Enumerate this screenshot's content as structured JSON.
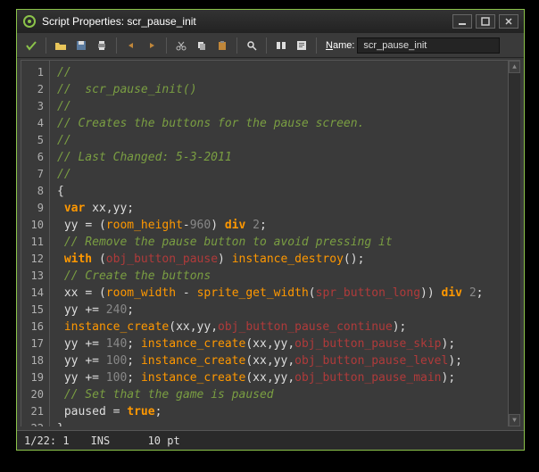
{
  "titlebar": {
    "title": "Script Properties: scr_pause_init"
  },
  "toolbar": {
    "name_label": "Name:",
    "name_value": "scr_pause_init"
  },
  "gutter": {
    "lines": 22
  },
  "code_lines": [
    {
      "t": "cmt",
      "text": "//"
    },
    {
      "t": "cmt",
      "text": "//  scr_pause_init()"
    },
    {
      "t": "cmt",
      "text": "//"
    },
    {
      "t": "cmt",
      "text": "// Creates the buttons for the pause screen."
    },
    {
      "t": "cmt",
      "text": "//"
    },
    {
      "t": "cmt",
      "text": "// Last Changed: 5-3-2011"
    },
    {
      "t": "cmt",
      "text": "//"
    },
    {
      "t": "raw",
      "html": "<span class='c-sym'>{</span>"
    },
    {
      "t": "raw",
      "html": " <span class='c-kw'>var</span> <span class='c-var'>xx,yy;</span>"
    },
    {
      "t": "raw",
      "html": " <span class='c-var'>yy</span> <span class='c-op'>=</span> <span class='c-op'>(</span><span class='c-fn'>room_height</span><span class='c-op'>-</span><span class='c-num'>960</span><span class='c-op'>)</span> <span class='c-kw'>div</span> <span class='c-num'>2</span><span class='c-op'>;</span>"
    },
    {
      "t": "raw",
      "html": " <span class='c-cmt'>// Remove the pause button to avoid pressing it</span>"
    },
    {
      "t": "raw",
      "html": " <span class='c-kw'>with</span> <span class='c-op'>(</span><span class='c-obj'>obj_button_pause</span><span class='c-op'>)</span> <span class='c-fn'>instance_destroy</span><span class='c-op'>();</span>"
    },
    {
      "t": "raw",
      "html": " <span class='c-cmt'>// Create the buttons</span>"
    },
    {
      "t": "raw",
      "html": " <span class='c-var'>xx</span> <span class='c-op'>=</span> <span class='c-op'>(</span><span class='c-fn'>room_width</span> <span class='c-op'>-</span> <span class='c-fn'>sprite_get_width</span><span class='c-op'>(</span><span class='c-obj'>spr_button_long</span><span class='c-op'>))</span> <span class='c-kw'>div</span> <span class='c-num'>2</span><span class='c-op'>;</span>"
    },
    {
      "t": "raw",
      "html": " <span class='c-var'>yy</span> <span class='c-op'>+=</span> <span class='c-num'>240</span><span class='c-op'>;</span>"
    },
    {
      "t": "raw",
      "html": " <span class='c-fn'>instance_create</span><span class='c-op'>(</span><span class='c-var'>xx</span><span class='c-op'>,</span><span class='c-var'>yy</span><span class='c-op'>,</span><span class='c-obj'>obj_button_pause_continue</span><span class='c-op'>);</span>"
    },
    {
      "t": "raw",
      "html": " <span class='c-var'>yy</span> <span class='c-op'>+=</span> <span class='c-num'>140</span><span class='c-op'>;</span> <span class='c-fn'>instance_create</span><span class='c-op'>(</span><span class='c-var'>xx</span><span class='c-op'>,</span><span class='c-var'>yy</span><span class='c-op'>,</span><span class='c-obj'>obj_button_pause_skip</span><span class='c-op'>);</span>"
    },
    {
      "t": "raw",
      "html": " <span class='c-var'>yy</span> <span class='c-op'>+=</span> <span class='c-num'>100</span><span class='c-op'>;</span> <span class='c-fn'>instance_create</span><span class='c-op'>(</span><span class='c-var'>xx</span><span class='c-op'>,</span><span class='c-var'>yy</span><span class='c-op'>,</span><span class='c-obj'>obj_button_pause_level</span><span class='c-op'>);</span>"
    },
    {
      "t": "raw",
      "html": " <span class='c-var'>yy</span> <span class='c-op'>+=</span> <span class='c-num'>100</span><span class='c-op'>;</span> <span class='c-fn'>instance_create</span><span class='c-op'>(</span><span class='c-var'>xx</span><span class='c-op'>,</span><span class='c-var'>yy</span><span class='c-op'>,</span><span class='c-obj'>obj_button_pause_main</span><span class='c-op'>);</span>"
    },
    {
      "t": "raw",
      "html": " <span class='c-cmt'>// Set that the game is paused</span>"
    },
    {
      "t": "raw",
      "html": " <span class='c-var'>paused</span> <span class='c-op'>=</span> <span class='c-kw'>true</span><span class='c-op'>;</span>"
    },
    {
      "t": "raw",
      "html": "<span class='c-sym'>}</span>"
    }
  ],
  "statusbar": {
    "position": "1/22: 1",
    "mode": "INS",
    "fontsize": "10 pt"
  },
  "colors": {
    "accent": "#8bc34a",
    "bg": "#3a3a3a",
    "comment": "#7a9e42",
    "keyword": "#ff9800",
    "object": "#b03a3a",
    "number": "#888888"
  }
}
